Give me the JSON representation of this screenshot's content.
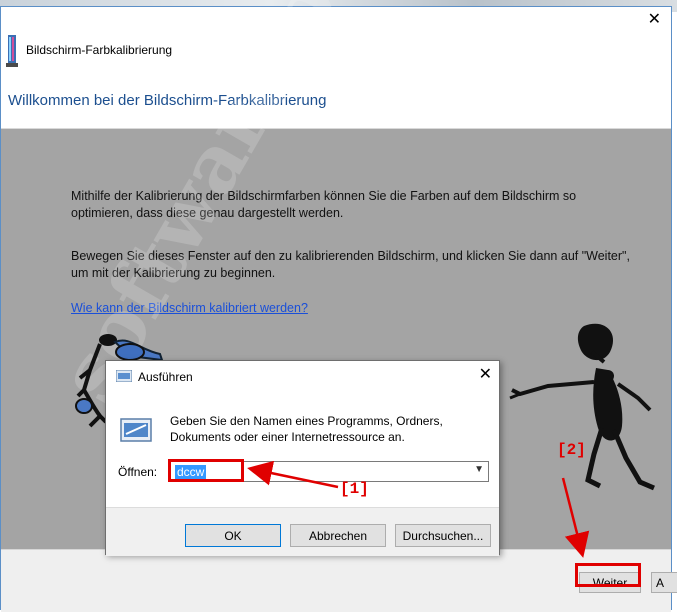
{
  "window": {
    "title": "Bildschirm-Farbkalibrierung",
    "header_title": "Willkommen bei der Bildschirm-Farbkalibrierung",
    "paragraph1": "Mithilfe der Kalibrierung der Bildschirmfarben können Sie die Farben auf dem Bildschirm so optimieren, dass diese genau dargestellt werden.",
    "paragraph2": "Bewegen Sie dieses Fenster auf den zu kalibrierenden Bildschirm, und klicken Sie dann auf \"Weiter\", um mit der Kalibrierung zu beginnen.",
    "help_link": "Wie kann der Bildschirm kalibriert werden?",
    "next_button": "Weiter",
    "second_button_partial": "A",
    "close_glyph": "✕"
  },
  "run_dialog": {
    "title": "Ausführen",
    "description": "Geben Sie den Namen eines Programms, Ordners, Dokuments oder einer Internetressource an.",
    "open_label": "Öffnen:",
    "open_value": "dccw",
    "ok_button": "OK",
    "cancel_button": "Abbrechen",
    "browse_button": "Durchsuchen...",
    "close_glyph": "✕"
  },
  "annotations": {
    "label1": "[1]",
    "label2": "[2]",
    "color": "#e00000"
  },
  "watermark": "software-ok.de",
  "colors": {
    "header_title": "#1c4f8f",
    "link": "#1a4fd8",
    "content_bg": "#a4a4a4"
  },
  "icons": [
    "calibration-app-icon",
    "run-dialog-icon",
    "combo-arrow-icon",
    "close-icon"
  ]
}
